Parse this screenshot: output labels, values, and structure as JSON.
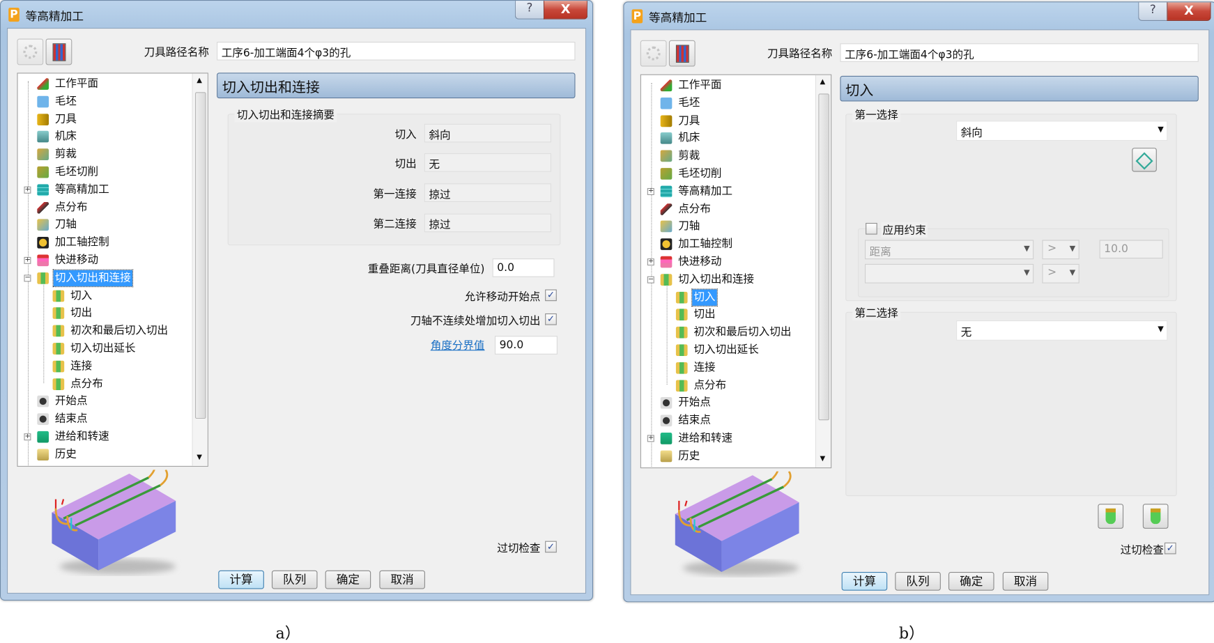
{
  "colors": {
    "selection": "#3399ff",
    "header": "#a9c3df",
    "link": "#1a6fc4",
    "close": "#c8483a"
  },
  "windows": [
    {
      "id": "a",
      "title": "等高精加工",
      "help_label": "?",
      "close_label": "X",
      "toolpath_name_label": "刀具路径名称",
      "toolpath_name_value": "工序6-加工端面4个φ3的孔",
      "tree_selected": "切入切出和连接",
      "panel_title": "切入切出和连接",
      "summary": {
        "group_label": "切入切出和连接摘要",
        "rows": [
          {
            "label": "切入",
            "value": "斜向"
          },
          {
            "label": "切出",
            "value": "无"
          },
          {
            "label": "第一连接",
            "value": "掠过"
          },
          {
            "label": "第二连接",
            "value": "掠过"
          }
        ]
      },
      "overlap_label": "重叠距离(刀具直径单位)",
      "overlap_value": "0.0",
      "allow_move_start_label": "允许移动开始点",
      "allow_move_start_checked": true,
      "add_at_axis_discontinuity_label": "刀轴不连续处增加切入切出",
      "add_at_axis_discontinuity_checked": true,
      "angle_threshold_label": "角度分界值",
      "angle_threshold_value": "90.0",
      "gouge_check_label": "过切检查",
      "gouge_check_checked": true,
      "buttons": [
        "计算",
        "队列",
        "确定",
        "取消"
      ],
      "caption": "a）"
    },
    {
      "id": "b",
      "title": "等高精加工",
      "help_label": "?",
      "close_label": "X",
      "toolpath_name_label": "刀具路径名称",
      "toolpath_name_value": "工序6-加工端面4个φ3的孔",
      "tree_selected": "切入",
      "panel_title": "切入",
      "first_choice": {
        "label": "第一选择",
        "value": "斜向"
      },
      "constraint": {
        "label": "应用约束",
        "checked": false,
        "row1_type": "距离",
        "row1_op": ">",
        "row1_value": "10.0",
        "row2_type": "",
        "row2_op": ">"
      },
      "second_choice": {
        "label": "第二选择",
        "value": "无"
      },
      "gouge_check_label": "过切检查",
      "gouge_check_checked": true,
      "buttons": [
        "计算",
        "队列",
        "确定",
        "取消"
      ],
      "caption": "b）"
    }
  ],
  "tree": [
    {
      "label": "工作平面",
      "level": 0,
      "icon": "workplane-icon"
    },
    {
      "label": "毛坯",
      "level": 0,
      "icon": "block-icon"
    },
    {
      "label": "刀具",
      "level": 0,
      "icon": "tool-icon"
    },
    {
      "label": "机床",
      "level": 0,
      "icon": "machine-icon"
    },
    {
      "label": "剪裁",
      "level": 0,
      "icon": "limit-icon"
    },
    {
      "label": "毛坯切削",
      "level": 0,
      "icon": "stock-cut-icon"
    },
    {
      "label": "等高精加工",
      "level": 0,
      "icon": "constant-z-icon",
      "expander": "+"
    },
    {
      "label": "点分布",
      "level": 0,
      "icon": "point-distribution-icon"
    },
    {
      "label": "刀轴",
      "level": 0,
      "icon": "tool-axis-icon"
    },
    {
      "label": "加工轴控制",
      "level": 0,
      "icon": "axis-control-icon"
    },
    {
      "label": "快进移动",
      "level": 0,
      "icon": "rapid-move-icon",
      "expander": "+"
    },
    {
      "label": "切入切出和连接",
      "level": 0,
      "icon": "leads-links-icon",
      "expander": "-"
    },
    {
      "label": "切入",
      "level": 1,
      "icon": "leads-links-icon"
    },
    {
      "label": "切出",
      "level": 1,
      "icon": "leads-links-icon"
    },
    {
      "label": "初次和最后切入切出",
      "level": 1,
      "icon": "leads-links-icon"
    },
    {
      "label": "切入切出延长",
      "level": 1,
      "icon": "leads-links-icon"
    },
    {
      "label": "连接",
      "level": 1,
      "icon": "leads-links-icon"
    },
    {
      "label": "点分布",
      "level": 1,
      "icon": "leads-links-icon"
    },
    {
      "label": "开始点",
      "level": 0,
      "icon": "start-point-icon"
    },
    {
      "label": "结束点",
      "level": 0,
      "icon": "end-point-icon"
    },
    {
      "label": "进给和转速",
      "level": 0,
      "icon": "feeds-speeds-icon",
      "expander": "+"
    },
    {
      "label": "历史",
      "level": 0,
      "icon": "history-icon"
    }
  ]
}
